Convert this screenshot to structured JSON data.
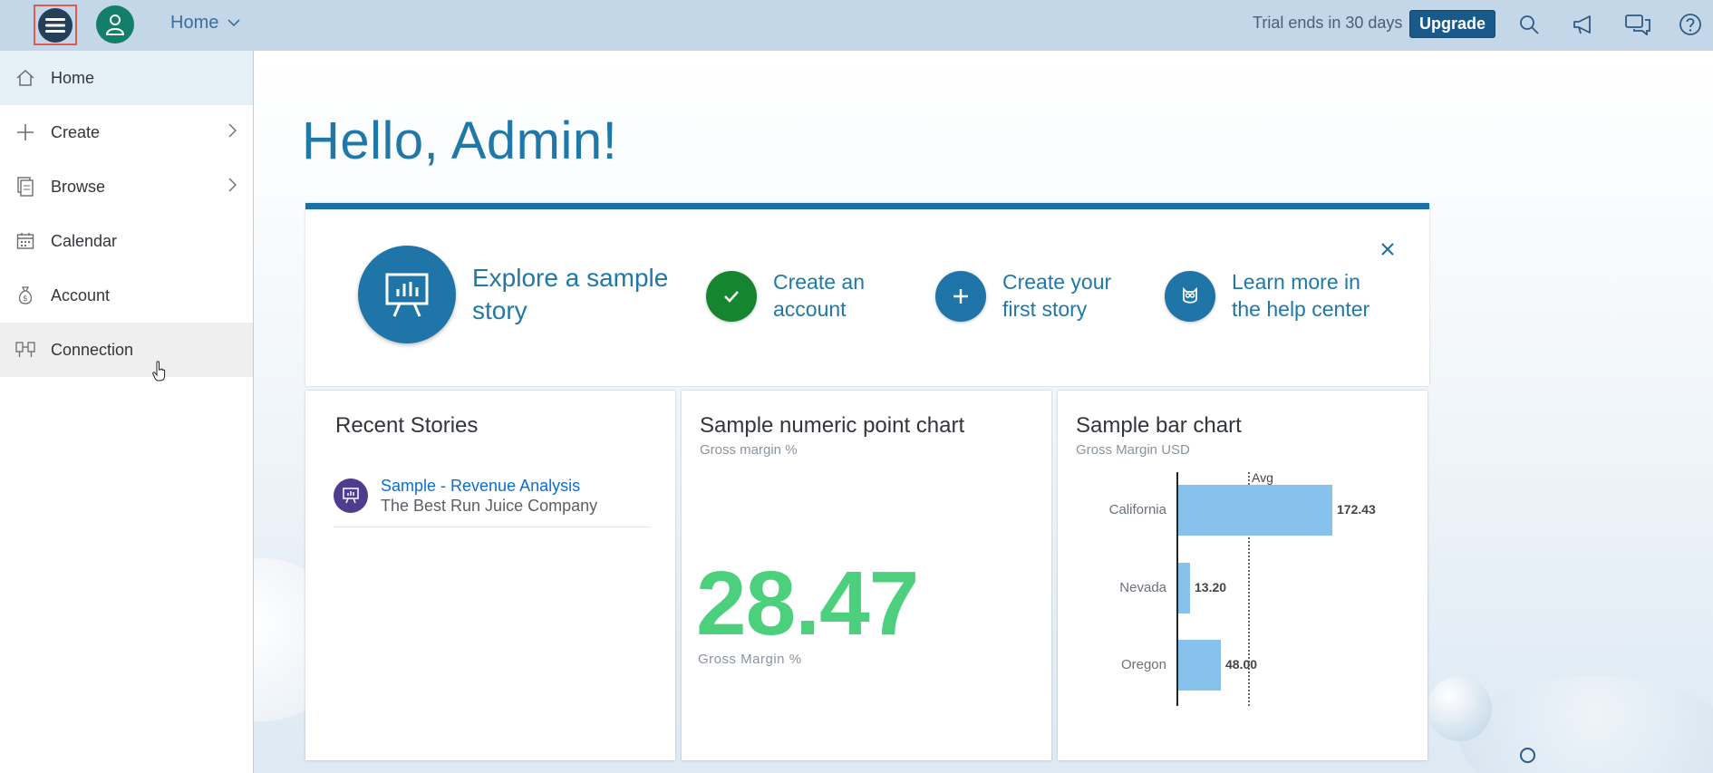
{
  "shell": {
    "title": "Home",
    "trial_text": "Trial ends in 30 days",
    "upgrade_label": "Upgrade"
  },
  "sidenav": {
    "items": [
      {
        "label": "Home",
        "icon": "home-icon"
      },
      {
        "label": "Create",
        "icon": "plus-icon"
      },
      {
        "label": "Browse",
        "icon": "browse-icon"
      },
      {
        "label": "Calendar",
        "icon": "calendar-icon"
      },
      {
        "label": "Account",
        "icon": "money-bag-icon"
      },
      {
        "label": "Connection",
        "icon": "connection-icon"
      }
    ]
  },
  "main": {
    "greeting": "Hello, Admin!",
    "welcome": {
      "steps": [
        {
          "label": "Explore a sample story"
        },
        {
          "label": "Create an account"
        },
        {
          "label": "Create your first story"
        },
        {
          "label": "Learn more in the help center"
        }
      ]
    },
    "recent": {
      "title": "Recent Stories",
      "items": [
        {
          "name": "Sample - Revenue Analysis",
          "company": "The Best Run Juice Company"
        }
      ]
    },
    "numeric": {
      "title": "Sample numeric point chart",
      "subtitle": "Gross margin %",
      "value": "28.47",
      "label": "Gross Margin %"
    },
    "barchart": {
      "title": "Sample bar chart",
      "subtitle": "Gross Margin USD",
      "avg_label": "Avg"
    }
  },
  "chart_data": {
    "type": "bar",
    "orientation": "horizontal",
    "title": "Sample bar chart",
    "subtitle": "Gross Margin USD",
    "categories": [
      "California",
      "Nevada",
      "Oregon"
    ],
    "values": [
      172.43,
      13.2,
      48.0
    ],
    "value_labels": [
      "172.43",
      "13.20",
      "48.00"
    ],
    "reference_line": {
      "label": "Avg",
      "value": 77.88
    },
    "colors": {
      "bar": "#87c2ec"
    }
  },
  "colors": {
    "accent": "#1f78a8",
    "kpi": "#4cd07d",
    "upgrade": "#1a5a8a"
  }
}
